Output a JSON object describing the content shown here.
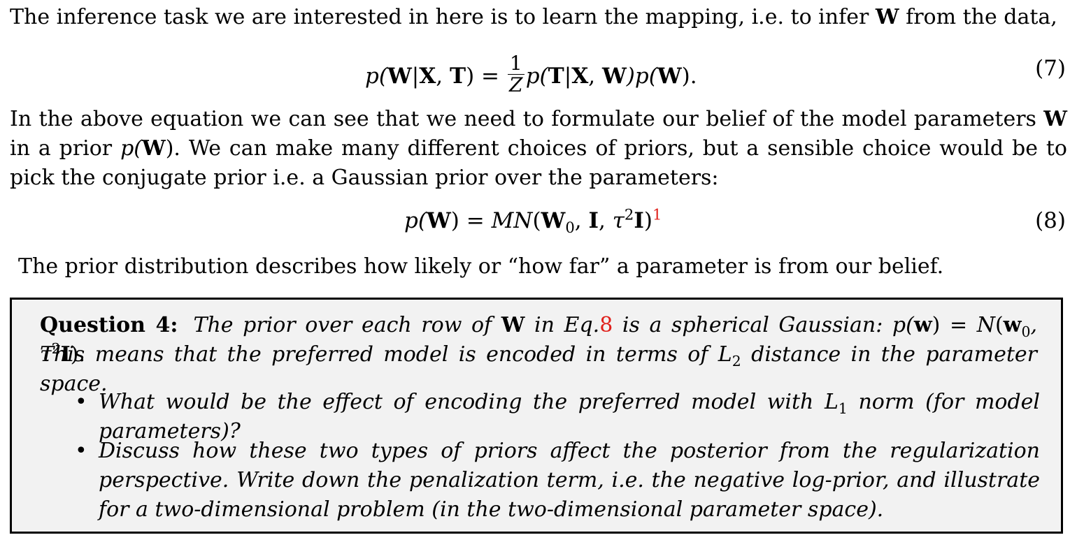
{
  "para1": "The inference task we are interested in here is to learn the mapping, i.e. to infer",
  "para1_sym": "W",
  "para1_end": "from the data,",
  "eq7": {
    "lhs": "p(",
    "W": "W",
    "bar": "|",
    "X": "X",
    "comma": ", ",
    "T": "T",
    "close": ") = ",
    "frac_num": "1",
    "frac_den": "Z",
    "rhs1": "p(",
    "rhs_bar": "|",
    "rhs2": ")p(",
    "rhs3": ").",
    "number": "(7)"
  },
  "para2": {
    "a": "In the above equation we can see that we need to formulate our belief of the model parameters",
    "sym": "W",
    "b": "in a prior",
    "prior": "p(",
    "prior_close": ").",
    "c": "We can make many different choices of priors, but a sensible choice would be to pick the conjugate prior i.e. a Gaussian prior over the parameters:"
  },
  "eq8": {
    "lhs": "p(",
    "lhs_close": ") = ",
    "mn": "MN",
    "open": "(",
    "W0": "W",
    "sub0": "0",
    "sep": ", ",
    "I": "I",
    "tau": "τ",
    "sq": "2",
    "close": ")",
    "footnote": "1",
    "number": "(8)"
  },
  "para3": "The prior distribution describes how likely or “how far” a parameter is from our belief.",
  "question": {
    "label": "Question 4:",
    "line1_a": "The prior over each row of",
    "line1_sym": "W",
    "line1_b": "in Eq.",
    "eq_ref": "8",
    "line1_c": "is a spherical Gaussian:",
    "formula_p": "p(",
    "formula_w": "w",
    "formula_mid": ") = ",
    "formula_N": "N",
    "formula_open": "(",
    "formula_w0": "w",
    "formula_sub0": "0",
    "formula_sep": ", ",
    "formula_tau": "τ",
    "formula_sq": "2",
    "formula_I": "I",
    "formula_end": ").",
    "line2_a": "This means that the preferred model is encoded in terms of L",
    "line2_sub": "2",
    "line2_b": "distance in the parameter space.",
    "bullet1_a": "What would be the effect of encoding the preferred model with L",
    "bullet1_sub": "1",
    "bullet1_b": "norm (for model parameters)?",
    "bullet2": "Discuss how these two types of priors affect the posterior from the regularization perspective. Write down the penalization term, i.e. the negative log-prior, and illustrate for a two-dimensional problem (in the two-dimensional parameter space).",
    "bullet_glyph": "•"
  },
  "colors": {
    "ref_red": "#e0201b",
    "box_bg": "#f2f2f2",
    "box_border": "#000000"
  }
}
